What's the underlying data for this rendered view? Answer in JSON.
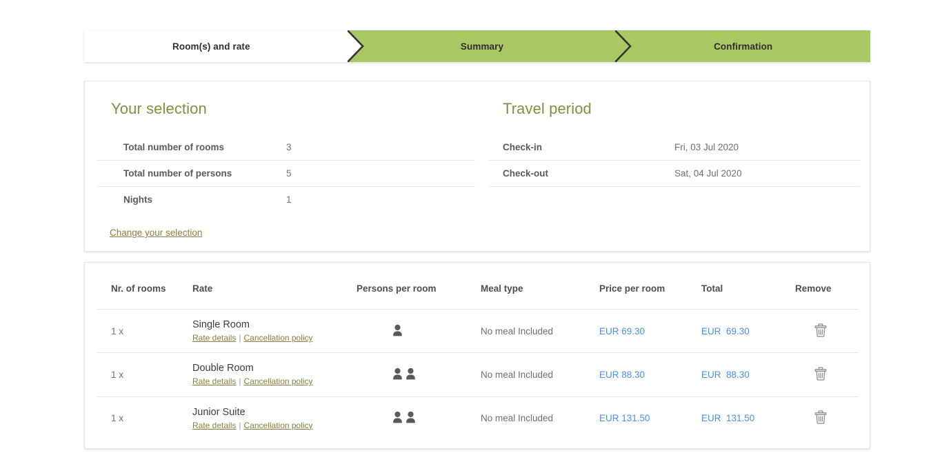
{
  "stepper": {
    "steps": [
      {
        "label": "Room(s) and rate",
        "state": "inactive"
      },
      {
        "label": "Summary",
        "state": "active"
      },
      {
        "label": "Confirmation",
        "state": "active"
      }
    ],
    "active_color": "#a9c763",
    "inactive_color": "#ffffff",
    "divider_color": "#333333"
  },
  "summary": {
    "selection": {
      "title": "Your selection",
      "rows": [
        {
          "key": "Total number of rooms",
          "value": "3"
        },
        {
          "key": "Total number of persons",
          "value": "5"
        },
        {
          "key": "Nights",
          "value": "1"
        }
      ],
      "change_link": "Change your selection"
    },
    "travel": {
      "title": "Travel period",
      "rows": [
        {
          "key": "Check-in",
          "value": "Fri, 03 Jul 2020"
        },
        {
          "key": "Check-out",
          "value": "Sat, 04 Jul 2020"
        }
      ]
    }
  },
  "rooms_table": {
    "headers": {
      "nr": "Nr. of rooms",
      "rate": "Rate",
      "persons": "Persons per room",
      "meal": "Meal type",
      "price": "Price per room",
      "total": "Total",
      "remove": "Remove"
    },
    "link_labels": {
      "rate_details": "Rate details",
      "separator": "|",
      "cancellation_policy": "Cancellation policy"
    },
    "price_color": "#4a90e2",
    "rows": [
      {
        "nr": "1 x",
        "room": "Single Room",
        "persons": 1,
        "meal": "No meal Included",
        "price": "EUR 69.30",
        "total": "EUR  69.30"
      },
      {
        "nr": "1 x",
        "room": "Double Room",
        "persons": 2,
        "meal": "No meal Included",
        "price": "EUR 88.30",
        "total": "EUR  88.30"
      },
      {
        "nr": "1 x",
        "room": "Junior Suite",
        "persons": 2,
        "meal": "No meal Included",
        "price": "EUR 131.50",
        "total": "EUR  131.50"
      }
    ],
    "icons": {
      "person": "person-icon",
      "trash": "trash-icon"
    }
  }
}
